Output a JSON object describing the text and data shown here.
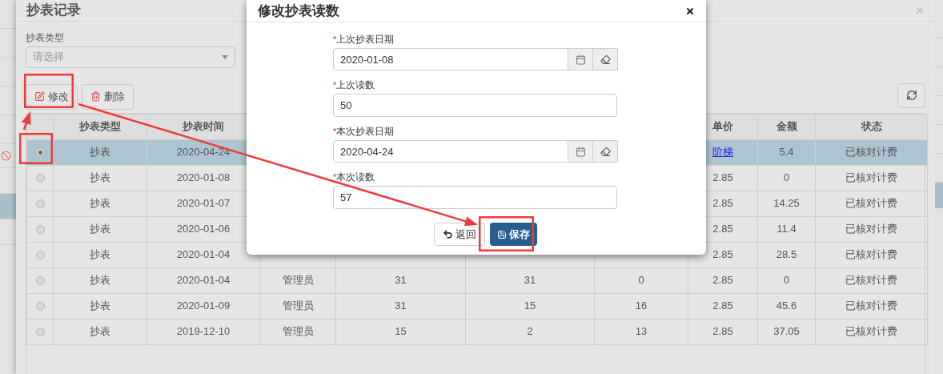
{
  "records_dialog": {
    "title": "抄表记录",
    "filter": {
      "label": "抄表类型",
      "placeholder": "请选择"
    },
    "toolbar": [
      {
        "kind": "edit",
        "label": "修改"
      },
      {
        "kind": "delete",
        "label": "删除"
      }
    ],
    "table": {
      "columns": {
        "type": "抄表类型",
        "time": "抄表时间",
        "unit_price": "单价",
        "amount": "金额",
        "status": "状态"
      },
      "rows": [
        {
          "selected": true,
          "type": "抄表",
          "time": "2020-04-24",
          "unit_price": "阶梯",
          "unit_price_link": true,
          "amount": "5.4",
          "status": "已核对计费"
        },
        {
          "selected": false,
          "type": "抄表",
          "time": "2020-01-08",
          "unit_price": "2.85",
          "unit_price_link": false,
          "amount": "0",
          "status": "已核对计费"
        },
        {
          "selected": false,
          "type": "抄表",
          "time": "2020-01-07",
          "unit_price": "2.85",
          "unit_price_link": false,
          "amount": "14.25",
          "status": "已核对计费"
        },
        {
          "selected": false,
          "type": "抄表",
          "time": "2020-01-06",
          "unit_price": "2.85",
          "unit_price_link": false,
          "amount": "11.4",
          "status": "已核对计费"
        },
        {
          "selected": false,
          "type": "抄表",
          "time": "2020-01-04",
          "unit_price": "2.85",
          "unit_price_link": false,
          "amount": "28.5",
          "status": "已核对计费"
        },
        {
          "selected": false,
          "type": "抄表",
          "time": "2020-01-04",
          "column_3": "管理员",
          "column_4": "31",
          "column_5": "31",
          "column_6": "0",
          "unit_price": "2.85",
          "unit_price_link": false,
          "amount": "0",
          "status": "已核对计费"
        },
        {
          "selected": false,
          "type": "抄表",
          "time": "2020-01-09",
          "column_3": "管理员",
          "column_4": "31",
          "column_5": "15",
          "column_6": "16",
          "unit_price": "2.85",
          "unit_price_link": false,
          "amount": "45.6",
          "status": "已核对计费"
        },
        {
          "selected": false,
          "type": "抄表",
          "time": "2019-12-10",
          "column_3": "管理员",
          "column_4": "15",
          "column_5": "2",
          "column_6": "13",
          "unit_price": "2.85",
          "unit_price_link": false,
          "amount": "37.05",
          "status": "已核对计费"
        }
      ]
    }
  },
  "edit_dialog": {
    "title": "修改抄表读数",
    "fields": [
      {
        "kind": "date",
        "label": "上次抄表日期",
        "required_mark": "*",
        "value": "2020-01-08"
      },
      {
        "kind": "text",
        "label": "上次读数",
        "required_mark": "*",
        "value": "50"
      },
      {
        "kind": "date",
        "label": "本次抄表日期",
        "required_mark": "*",
        "value": "2020-04-24"
      },
      {
        "kind": "text",
        "label": "本次读数",
        "required_mark": "*",
        "value": "57"
      }
    ],
    "buttons": [
      {
        "kind": "back",
        "label": "返回"
      },
      {
        "kind": "save",
        "label": "保存"
      }
    ]
  }
}
